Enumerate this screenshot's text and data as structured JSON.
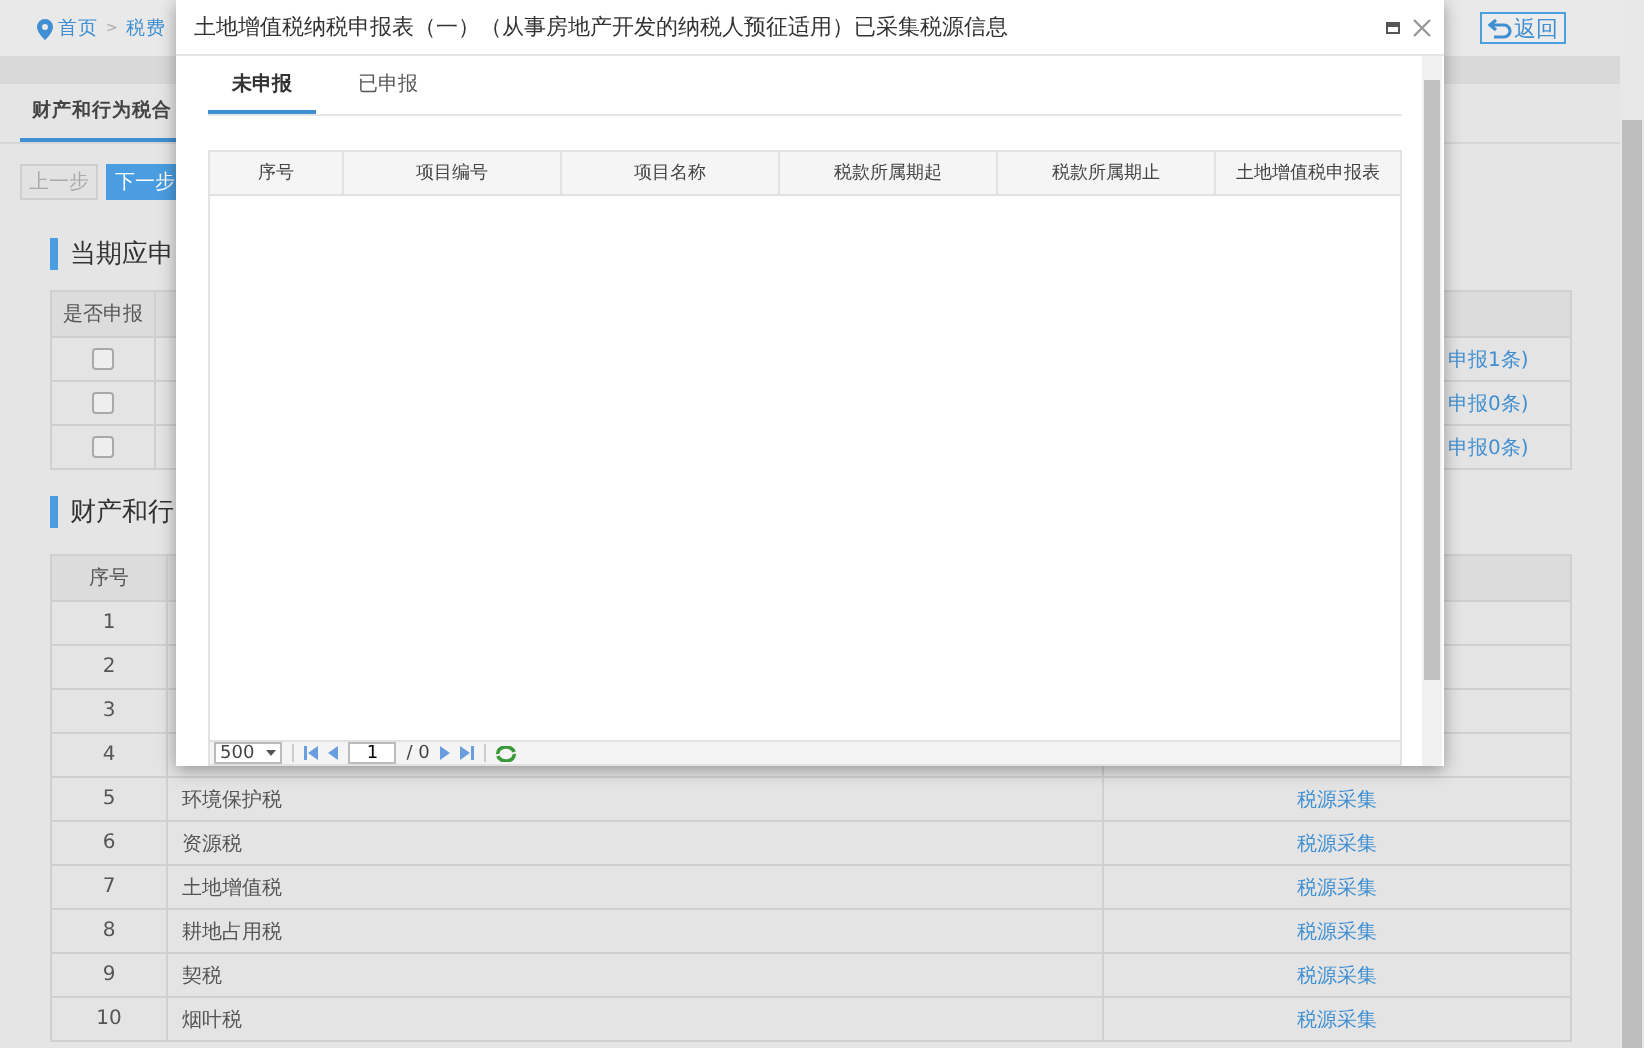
{
  "breadcrumb": {
    "home": "首页",
    "separator": ">",
    "current": "税费"
  },
  "return_button": "返回",
  "page_tab": {
    "label": "财产和行为税合",
    "selected": true
  },
  "steps": [
    {
      "label": "上一步",
      "disabled": true
    },
    {
      "label": "下一步",
      "disabled": false
    }
  ],
  "section_1": {
    "title": "当期应申",
    "table": {
      "columns": [
        "是否申报"
      ],
      "rows": [
        {
          "checked": false,
          "column_3": "申报1条)"
        },
        {
          "checked": false,
          "column_3": "申报0条)"
        },
        {
          "checked": false,
          "column_3": "申报0条)"
        }
      ]
    }
  },
  "section_2": {
    "title": "财产和行",
    "table": {
      "columns": [
        "序号"
      ],
      "rows": [
        {
          "number": "1"
        },
        {
          "number": "2"
        },
        {
          "number": "3"
        },
        {
          "number": "4"
        },
        {
          "number": "5",
          "name": "环境保护税",
          "action": "税源采集"
        },
        {
          "number": "6",
          "name": "资源税",
          "action": "税源采集"
        },
        {
          "number": "7",
          "name": "土地增值税",
          "action": "税源采集"
        },
        {
          "number": "8",
          "name": "耕地占用税",
          "action": "税源采集"
        },
        {
          "number": "9",
          "name": "契税",
          "action": "税源采集"
        },
        {
          "number": "10",
          "name": "烟叶税",
          "action": "税源采集"
        }
      ]
    }
  },
  "dialog": {
    "title": "土地增值税纳税申报表（一）（从事房地产开发的纳税人预征适用）已采集税源信息",
    "tabs": [
      {
        "label": "未申报",
        "selected": true
      },
      {
        "label": "已申报",
        "selected": false
      }
    ],
    "grid": {
      "columns": [
        "序号",
        "项目编号",
        "项目名称",
        "税款所属期起",
        "税款所属期止",
        "土地增值税申报表"
      ]
    },
    "pager": {
      "page_size": "500",
      "page": "1",
      "total": "/ 0"
    }
  }
}
